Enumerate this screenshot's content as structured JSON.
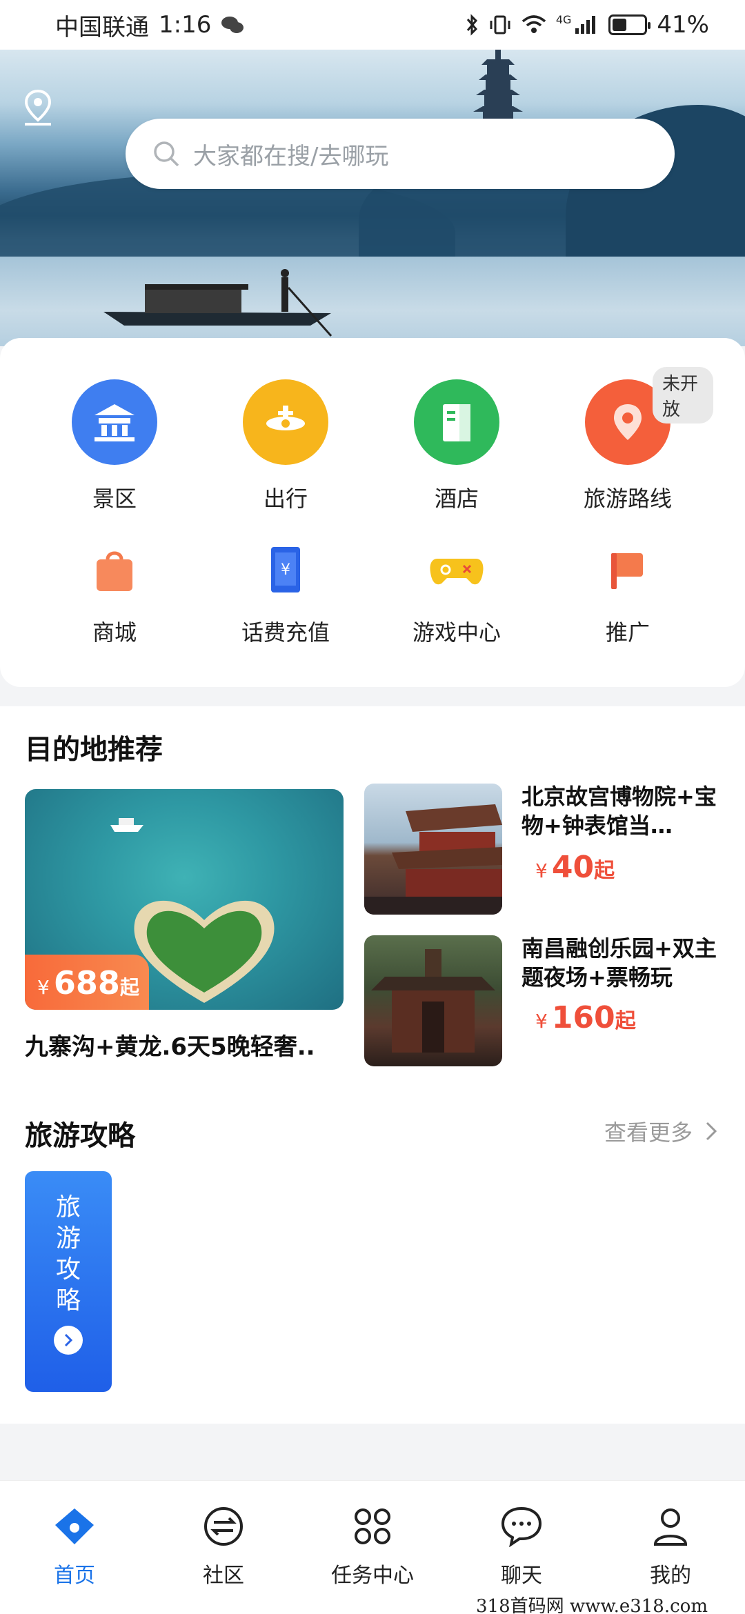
{
  "status_bar": {
    "carrier": "中国联通",
    "time": "1:16",
    "battery": "41%",
    "network": "4G"
  },
  "search": {
    "placeholder": "大家都在搜/去哪玩"
  },
  "quick_menu": {
    "row1": [
      {
        "label": "景区",
        "icon": "scenic-temple-icon",
        "color": "#3f7ef0"
      },
      {
        "label": "出行",
        "icon": "airplane-icon",
        "color": "#f7b51c"
      },
      {
        "label": "酒店",
        "icon": "hotel-icon",
        "color": "#2fb95b"
      },
      {
        "label": "旅游路线",
        "icon": "route-pin-icon",
        "color": "#f45f3b",
        "badge": "未开放"
      }
    ],
    "row2": [
      {
        "label": "商城",
        "icon": "shopping-bag-icon"
      },
      {
        "label": "话费充值",
        "icon": "recharge-icon"
      },
      {
        "label": "游戏中心",
        "icon": "gamepad-icon"
      },
      {
        "label": "推广",
        "icon": "flag-icon"
      }
    ]
  },
  "destinations": {
    "title": "目的地推荐",
    "featured": {
      "title": "九寨沟+黄龙.6天5晚轻奢..",
      "currency": "¥",
      "price": "688",
      "suffix": "起"
    },
    "items": [
      {
        "title": "北京故宫博物院+宝物+钟表馆当…",
        "currency": "¥",
        "price": "40",
        "suffix": "起"
      },
      {
        "title": "南昌融创乐园+双主题夜场+票畅玩",
        "currency": "¥",
        "price": "160",
        "suffix": "起"
      }
    ]
  },
  "guides": {
    "title": "旅游攻略",
    "more": "查看更多",
    "card_text": "旅游攻略"
  },
  "bottom_nav": [
    {
      "label": "首页",
      "icon": "home-icon",
      "active": true
    },
    {
      "label": "社区",
      "icon": "exchange-icon"
    },
    {
      "label": "任务中心",
      "icon": "apps-icon"
    },
    {
      "label": "聊天",
      "icon": "chat-bubble-icon"
    },
    {
      "label": "我的",
      "icon": "user-icon"
    }
  ],
  "watermark": "318首码网 www.e318.com",
  "colors": {
    "accent": "#1a73e8",
    "price": "#ef4f3a"
  }
}
